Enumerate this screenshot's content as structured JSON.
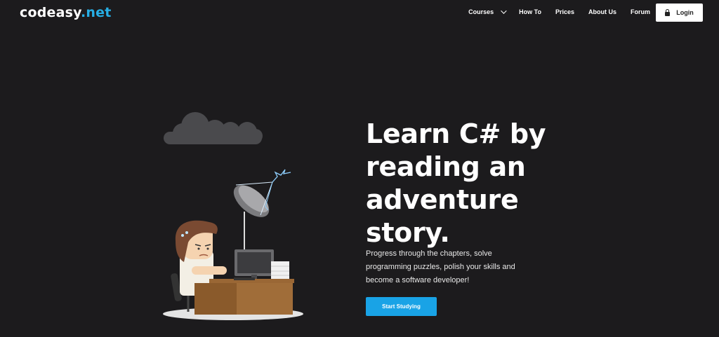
{
  "brand": {
    "name": "codeasy",
    "suffix": ".net",
    "accent": "#27aee4"
  },
  "nav": {
    "items": [
      {
        "label": "Courses",
        "dropdown": true
      },
      {
        "label": "How To"
      },
      {
        "label": "Prices"
      },
      {
        "label": "About Us"
      },
      {
        "label": "Forum"
      }
    ],
    "login_label": "Login",
    "login_icon": "lock-icon"
  },
  "hero": {
    "headline": [
      "Learn C# by",
      "reading an",
      "adventure",
      "story."
    ],
    "subtitle": "Progress through the chapters, solve programming puzzles, polish your skills and become a software developer!",
    "cta_label": "Start Studying",
    "cta_color": "#19a3e6"
  },
  "colors": {
    "background": "#1c1b1d",
    "desk": "#8a5a2b"
  }
}
